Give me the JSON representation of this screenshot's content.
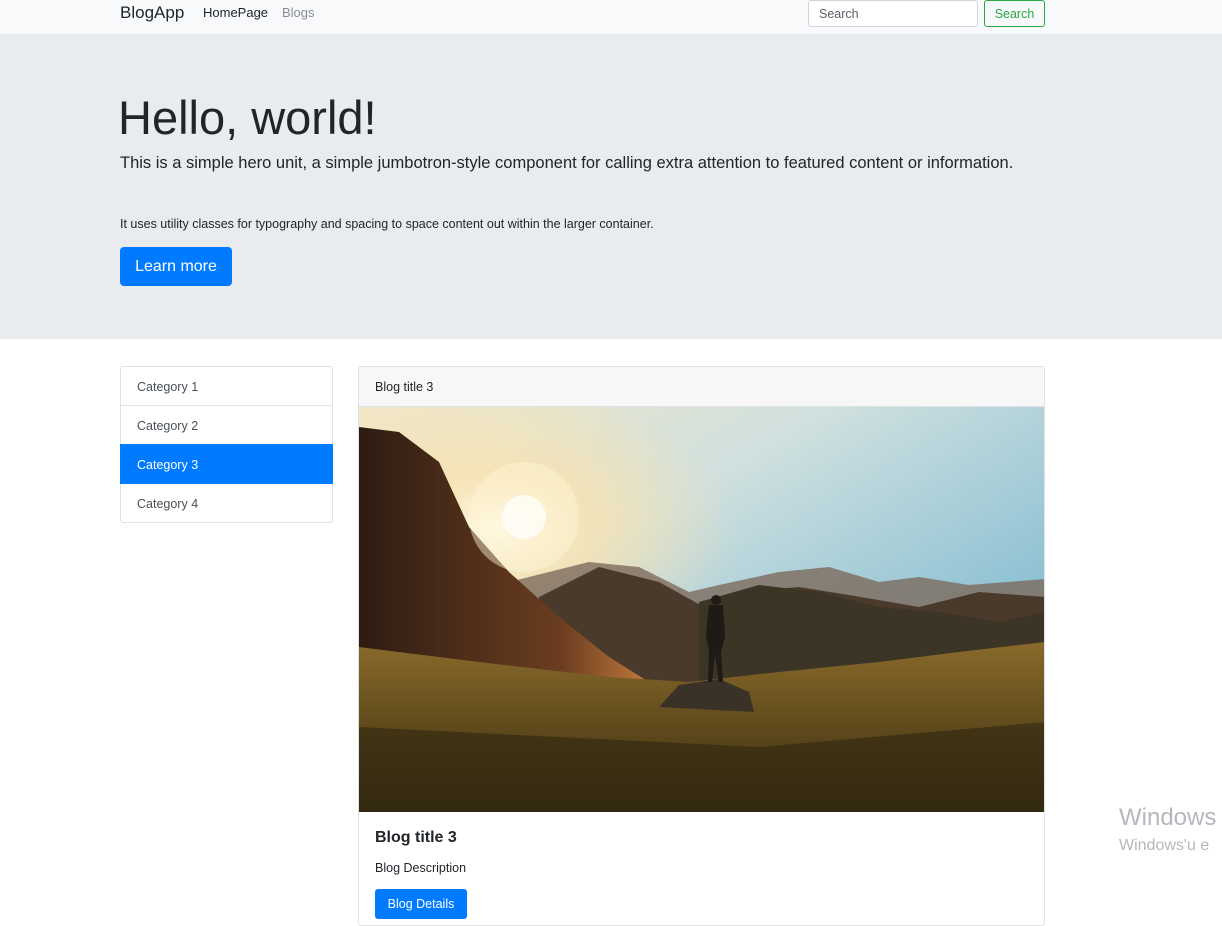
{
  "navbar": {
    "brand": "BlogApp",
    "links": [
      {
        "label": "HomePage",
        "active": true
      },
      {
        "label": "Blogs",
        "active": false
      }
    ],
    "search": {
      "placeholder": "Search",
      "value": "",
      "button_label": "Search"
    }
  },
  "jumbotron": {
    "title": "Hello, world!",
    "lead": "This is a simple hero unit, a simple jumbotron-style component for calling extra attention to featured content or information.",
    "text": "It uses utility classes for typography and spacing to space content out within the larger container.",
    "button_label": "Learn more"
  },
  "categories": {
    "items": [
      {
        "label": "Category 1",
        "active": false
      },
      {
        "label": "Category 2",
        "active": false
      },
      {
        "label": "Category 3",
        "active": true
      },
      {
        "label": "Category 4",
        "active": false
      }
    ]
  },
  "blog_card": {
    "header": "Blog title 3",
    "image_description": "hiker standing on a rock in a mountain valley at sunrise",
    "title": "Blog title 3",
    "description": "Blog Description",
    "button_label": "Blog Details"
  },
  "watermark": {
    "title": "Windows",
    "subtitle": "Windows'u e"
  },
  "colors": {
    "primary": "#007bff",
    "success": "#28a745",
    "navbar_bg": "#f8f9fa",
    "jumbotron_bg": "#e9ecef"
  }
}
